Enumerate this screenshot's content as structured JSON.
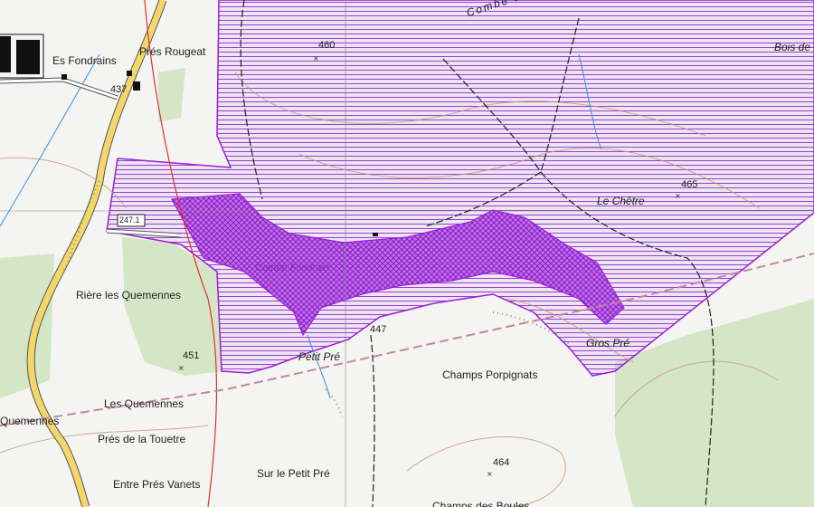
{
  "colors": {
    "background": "#f4f4f2",
    "forest": "#d4e6c6",
    "protected_area_stroke": "#9b1fd6",
    "protected_area_hatch": "#a040d8",
    "core_zone_fill": "#b04ae0",
    "main_road": "#f3d76a",
    "contour": "#c89868",
    "stream": "#3a8fd8",
    "railway_red": "#e03030",
    "boundary": "#c0889c"
  },
  "labels": {
    "es_fondrains": "Es Fondrains",
    "pres_rougeat": "Prés Rougeat",
    "combe_du_chetre": "Combe du Chêtre",
    "bois_de": "Bois de",
    "le_chetre": "Le Chêtre",
    "riere_les_quemennes": "Rière les Quemennes",
    "petit_pre": "Petit Pré",
    "gros_pre": "Gros Pré",
    "champs_porpignats": "Champs Porpignats",
    "les_quemennes": "Les Quemennes",
    "quemennes_left": "Quemennes",
    "pres_de_la_touetre": "Prés de la Touetre",
    "sur_le_petit_pre": "Sur le Petit Pré",
    "entre_pres_vanets": "Entre Prés Vanets",
    "champs_des_boules": "Champs des Boules",
    "core_zone_name": "Combe Fondrain"
  },
  "spot_heights": {
    "h460": "460",
    "h437": "437",
    "h465": "465",
    "h451": "451",
    "h447": "447",
    "h464": "464"
  },
  "road_numbers": {
    "r247": "247.1"
  },
  "icons": {
    "spot_height_marker": "x-mark",
    "building": "black-square"
  }
}
